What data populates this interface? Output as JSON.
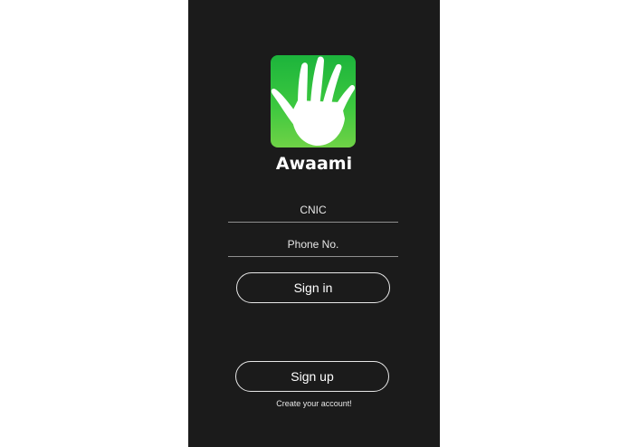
{
  "app": {
    "name": "Awaami",
    "logo_icon": "hand-icon",
    "logo_color": "#2fbe3e"
  },
  "form": {
    "cnic_placeholder": "CNIC",
    "phone_placeholder": "Phone No."
  },
  "actions": {
    "signin_label": "Sign in",
    "signup_label": "Sign up",
    "signup_hint": "Create your account!"
  },
  "theme": {
    "background": "#1b1b1b",
    "text": "#ffffff"
  }
}
